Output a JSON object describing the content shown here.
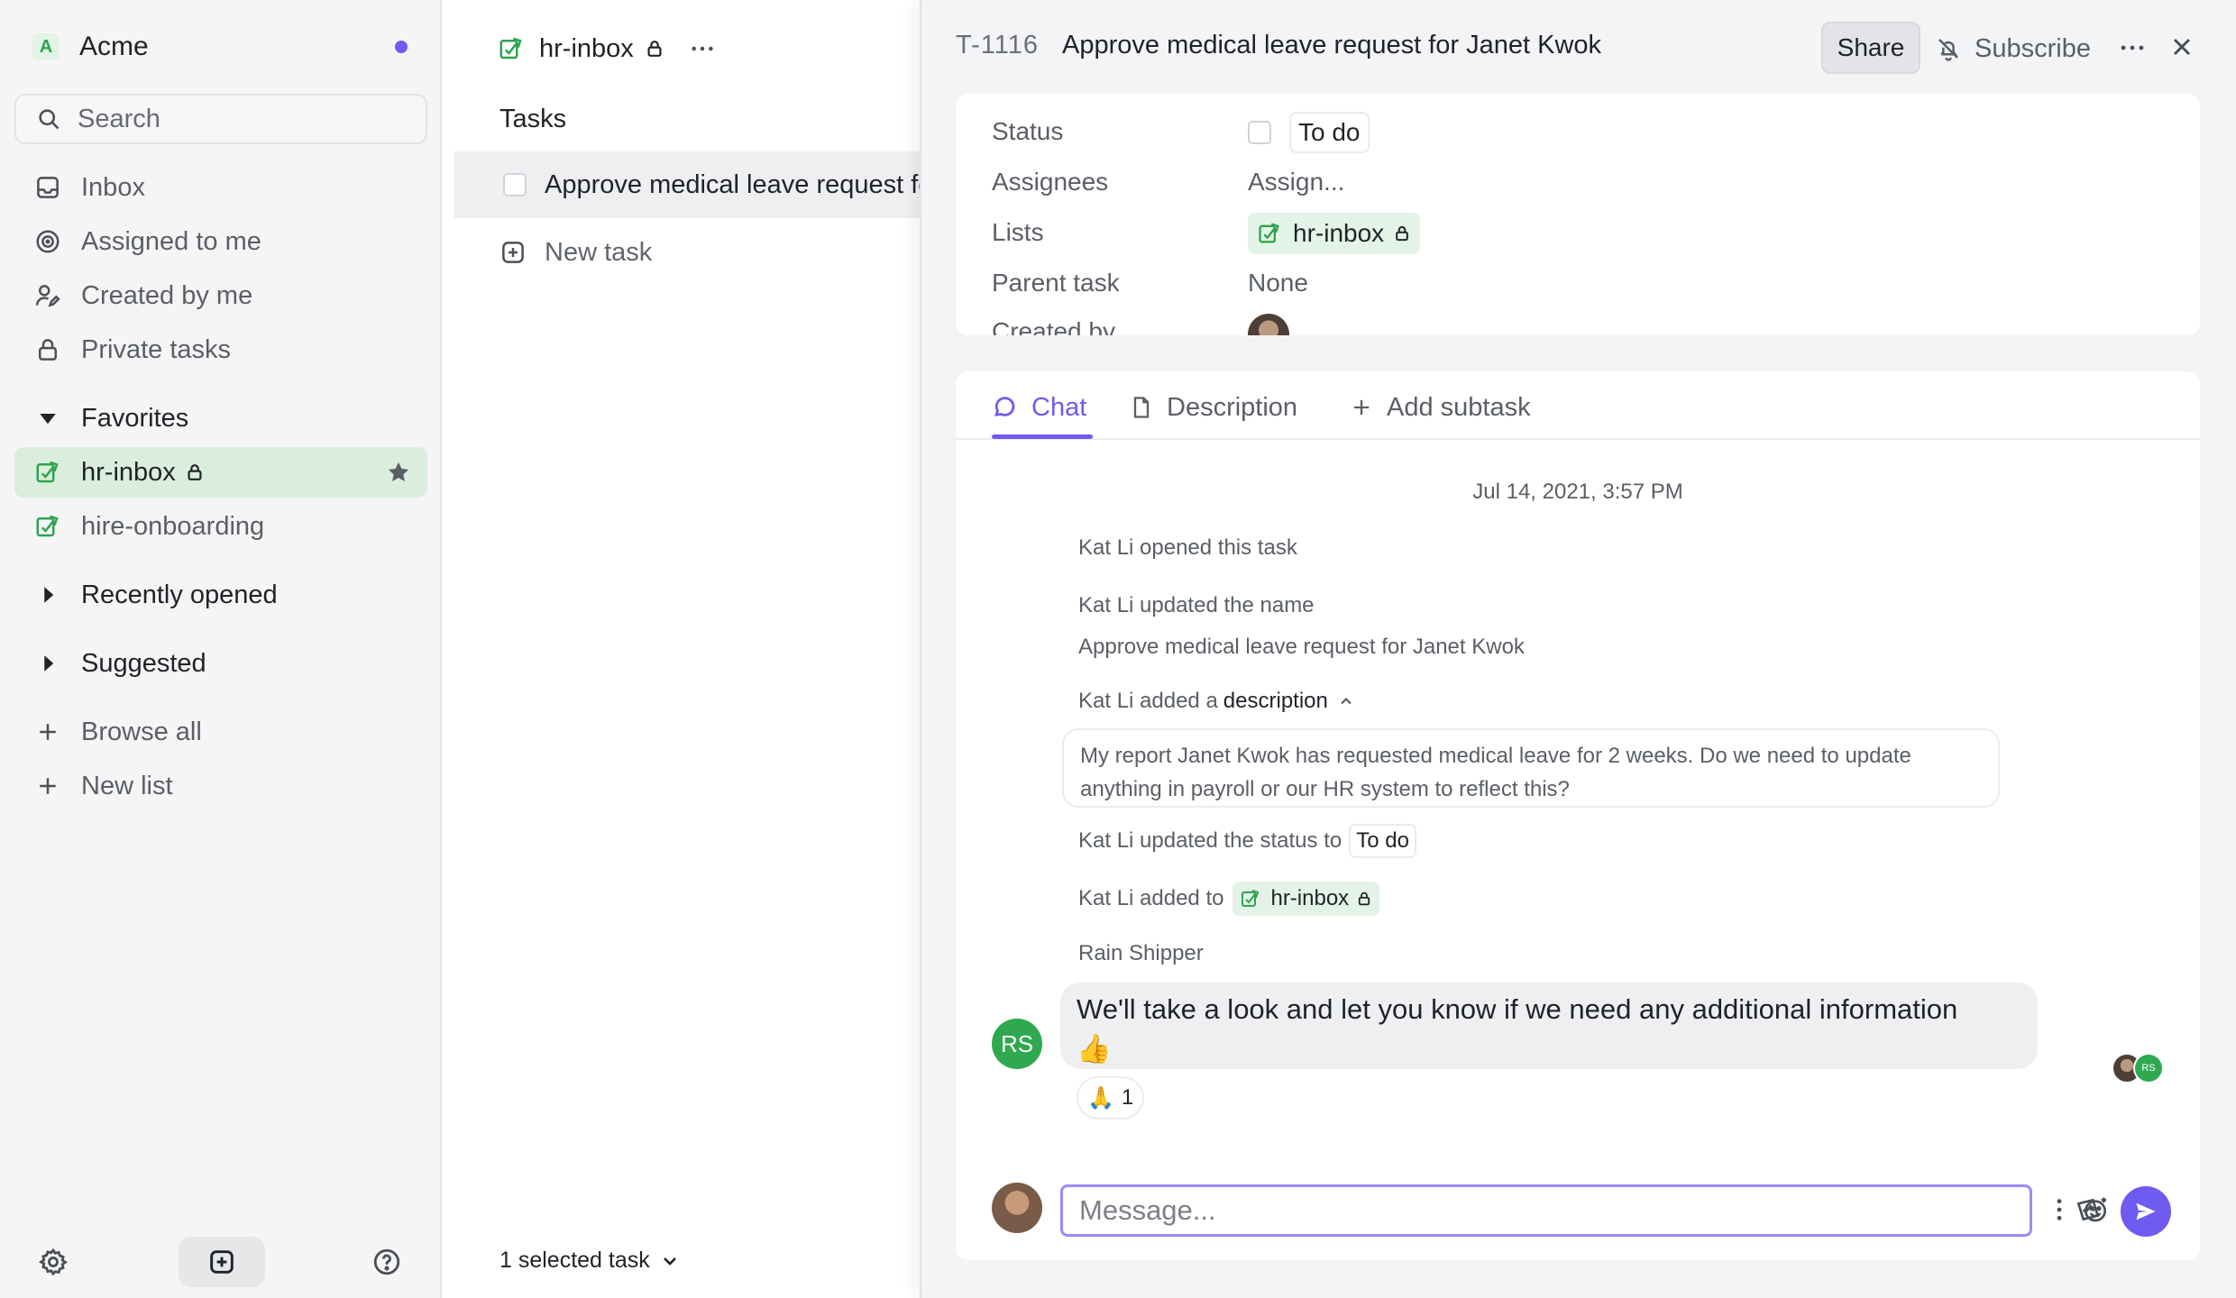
{
  "sidebar": {
    "workspace": {
      "initial": "A",
      "name": "Acme"
    },
    "search_placeholder": "Search",
    "nav": [
      {
        "label": "Inbox",
        "icon": "inbox-icon"
      },
      {
        "label": "Assigned to me",
        "icon": "target-icon"
      },
      {
        "label": "Created by me",
        "icon": "user-pen-icon"
      },
      {
        "label": "Private tasks",
        "icon": "lock-icon"
      }
    ],
    "favorites_label": "Favorites",
    "favorites": [
      {
        "label": "hr-inbox",
        "private": true,
        "starred": true,
        "active": true
      },
      {
        "label": "hire-onboarding",
        "private": false,
        "starred": false,
        "active": false
      }
    ],
    "recently_opened_label": "Recently opened",
    "suggested_label": "Suggested",
    "browse_all_label": "Browse all",
    "new_list_label": "New list"
  },
  "list": {
    "name": "hr-inbox",
    "section_title": "Tasks",
    "tasks": [
      {
        "title": "Approve medical leave request for Janet Kwok",
        "selected": true
      }
    ],
    "new_task_label": "New task",
    "selected_count_label": "1 selected task"
  },
  "detail": {
    "id": "T-1116",
    "title": "Approve medical leave request for Janet Kwok",
    "share_label": "Share",
    "subscribe_label": "Subscribe",
    "properties": {
      "status_label": "Status",
      "status_value": "To do",
      "assignees_label": "Assignees",
      "assignees_value": "Assign...",
      "lists_label": "Lists",
      "lists_value": "hr-inbox",
      "parent_label": "Parent task",
      "parent_value": "None",
      "created_by_label": "Created by"
    },
    "tabs": {
      "chat": "Chat",
      "description": "Description",
      "add_subtask": "Add subtask"
    },
    "chat": {
      "date": "Jul 14, 2021, 3:57 PM",
      "opened": "Kat Li opened this task",
      "updated_name": "Kat Li updated the name",
      "new_name": "Approve medical leave request for Janet Kwok",
      "added_desc_prefix": "Kat Li added a",
      "added_desc_word": "description",
      "description_text": "My report Janet Kwok has requested medical leave for 2 weeks. Do we need to update anything in payroll or our HR system to reflect this?",
      "status_prefix": "Kat Li updated the status to",
      "status_value": "To do",
      "added_to_prefix": "Kat Li added to",
      "added_to_list": "hr-inbox",
      "author": "Rain Shipper",
      "author_initials": "RS",
      "message": "We'll take a look and let you know if we need any additional information",
      "message_emoji": "👍",
      "reaction_emoji": "🙏",
      "reaction_count": "1",
      "seen_initials": "RS",
      "composer_placeholder": "Message..."
    }
  },
  "colors": {
    "accent": "#6f5bf0",
    "list_green": "#2ea44f",
    "active_bg": "#dbeedd"
  }
}
